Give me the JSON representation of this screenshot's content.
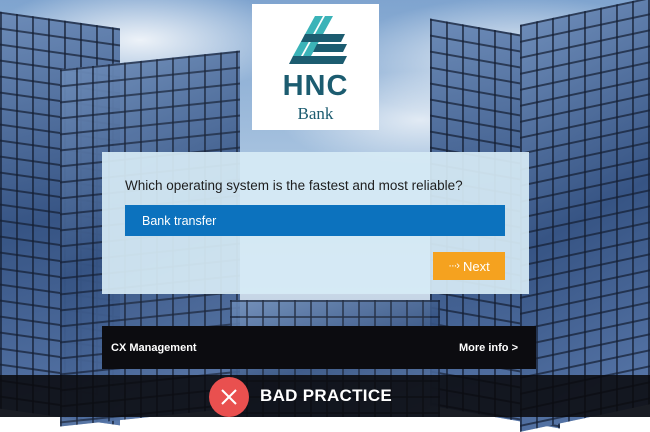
{
  "logo": {
    "name": "HNC",
    "sub": "Bank",
    "icon": "hnc-logo-icon",
    "color": "#1c5c70",
    "accent": "#3bb3b8"
  },
  "quiz": {
    "question": "Which operating system is the fastest and most reliable?",
    "answer_value": "Bank transfer",
    "next_label": "Next",
    "next_icon": "dotted-arrow-icon"
  },
  "info_bar": {
    "title": "CX Management",
    "link": "More info >"
  },
  "verdict": {
    "label": "BAD PRACTICE",
    "icon": "close-icon",
    "badge_color": "#e9504f"
  },
  "colors": {
    "answer_bg": "#0c72be",
    "next_bg": "#f5a21f",
    "panel_bg": "#d6ebf5",
    "bar_bg": "#0c0c10"
  }
}
